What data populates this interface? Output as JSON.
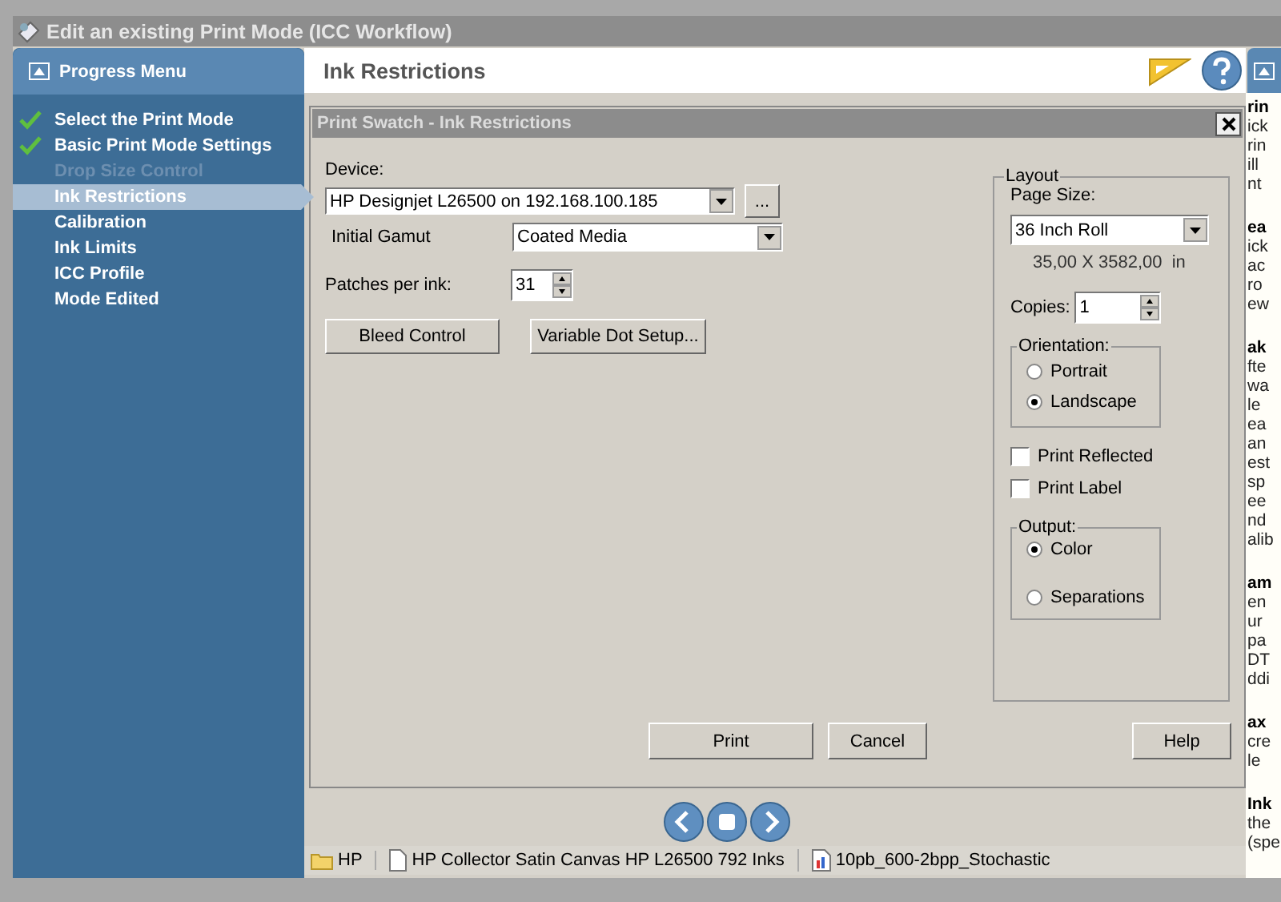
{
  "window": {
    "title": "Edit an existing Print Mode (ICC Workflow)"
  },
  "sidebar": {
    "title": "Progress Menu",
    "items": [
      {
        "label": "Select the Print Mode",
        "done": true,
        "disabled": false,
        "selected": false
      },
      {
        "label": "Basic Print Mode Settings",
        "done": true,
        "disabled": false,
        "selected": false
      },
      {
        "label": "Drop Size Control",
        "done": false,
        "disabled": true,
        "selected": false
      },
      {
        "label": "Ink Restrictions",
        "done": false,
        "disabled": false,
        "selected": true
      },
      {
        "label": "Calibration",
        "done": false,
        "disabled": false,
        "selected": false
      },
      {
        "label": "Ink Limits",
        "done": false,
        "disabled": false,
        "selected": false
      },
      {
        "label": "ICC Profile",
        "done": false,
        "disabled": false,
        "selected": false
      },
      {
        "label": "Mode Edited",
        "done": false,
        "disabled": false,
        "selected": false
      }
    ]
  },
  "page_header": {
    "title": "Ink Restrictions"
  },
  "dialog": {
    "title": "Print Swatch - Ink Restrictions",
    "device": {
      "label": "Device:",
      "value": "HP Designjet L26500 on 192.168.100.185",
      "browse": "..."
    },
    "gamut": {
      "label": "Initial Gamut",
      "value": "Coated Media"
    },
    "patches": {
      "label": "Patches per ink:",
      "value": "31"
    },
    "buttons": [
      "Bleed Control",
      "Variable Dot Setup..."
    ],
    "layout": {
      "title": "Layout",
      "page_size_label": "Page Size:",
      "page_size": "36 Inch Roll",
      "dimensions": "35,00 X 3582,00  in",
      "copies_label": "Copies:",
      "copies": "1",
      "orientation": {
        "title": "Orientation:",
        "options": [
          {
            "label": "Portrait",
            "selected": false
          },
          {
            "label": "Landscape",
            "selected": true
          }
        ]
      },
      "checkboxes": [
        {
          "label": "Print Reflected",
          "checked": false
        },
        {
          "label": "Print Label",
          "checked": false
        }
      ],
      "output": {
        "title": "Output:",
        "options": [
          {
            "label": "Color",
            "selected": true
          },
          {
            "label": "Separations",
            "selected": false
          }
        ]
      }
    },
    "footer_buttons": [
      "Print",
      "Cancel",
      "Help"
    ]
  },
  "status_bar": [
    {
      "kind": "folder",
      "text": "HP"
    },
    {
      "kind": "document",
      "text": "HP Collector Satin Canvas HP L26500 792 Inks"
    },
    {
      "kind": "image",
      "text": "10pb_600-2bpp_Stochastic"
    }
  ],
  "help_panel": {
    "paragraphs": [
      {
        "heading": "rin",
        "lines": [
          "ick",
          "rin",
          "ill",
          "nt"
        ]
      },
      {
        "heading": "ea",
        "lines": [
          "ick",
          "ac",
          "ro",
          "ew"
        ]
      },
      {
        "heading": "ak",
        "lines": [
          "fte",
          "wa",
          "le",
          "ea",
          "an",
          "est",
          "sp",
          "ee",
          "nd",
          "alib"
        ]
      },
      {
        "heading": "am",
        "lines": [
          "en",
          "ur",
          "pa",
          "DT",
          "ddi"
        ]
      },
      {
        "heading": "ax",
        "lines": [
          "cre",
          "le"
        ]
      },
      {
        "heading": "Ink",
        "lines": [
          "the",
          "(spe"
        ]
      }
    ]
  }
}
